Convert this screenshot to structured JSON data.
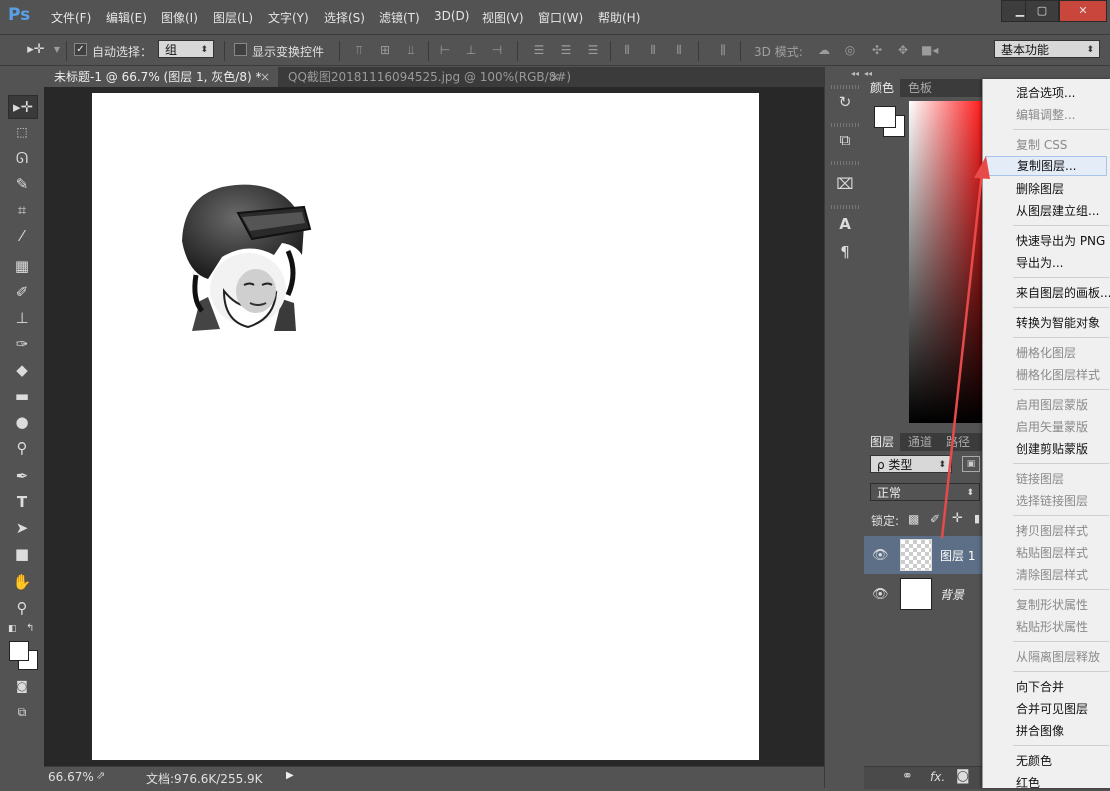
{
  "app": {
    "logo": "Ps"
  },
  "menubar": {
    "items": [
      "文件(F)",
      "编辑(E)",
      "图像(I)",
      "图层(L)",
      "文字(Y)",
      "选择(S)",
      "滤镜(T)",
      "3D(D)",
      "视图(V)",
      "窗口(W)",
      "帮助(H)"
    ]
  },
  "window_controls": {
    "minimize": "▁",
    "maximize": "▢",
    "close": "✕"
  },
  "options": {
    "auto_select_label": "自动选择：",
    "auto_select_value": "组",
    "show_transform_label": "显示变换控件",
    "mode_3d_label": "3D 模式:",
    "workspace_value": "基本功能"
  },
  "tabs": [
    {
      "label": "未标题-1 @ 66.7% (图层 1, 灰色/8) *",
      "close": "×",
      "active": true
    },
    {
      "label": "QQ截图20181116094525.jpg @ 100%(RGB/8#)",
      "close": "×",
      "active": false
    }
  ],
  "status": {
    "zoom": "66.67%",
    "doc_info": "文档:976.6K/255.9K"
  },
  "color_panel": {
    "tabs": [
      "颜色",
      "色板"
    ]
  },
  "layers_panel": {
    "tabs": [
      "图层",
      "通道",
      "路径"
    ],
    "filter_value": "ρ 类型",
    "blend_mode": "正常",
    "lock_label": "锁定:",
    "layers": [
      {
        "name": "图层 1",
        "selected": true,
        "italic": false
      },
      {
        "name": "背景",
        "selected": false,
        "italic": true
      }
    ],
    "footer_fx": "fx."
  },
  "context_menu": {
    "items": [
      {
        "label": "混合选项...",
        "enabled": true
      },
      {
        "label": "编辑调整...",
        "enabled": false
      },
      {
        "label": "复制 CSS",
        "enabled": false
      },
      {
        "label": "复制图层...",
        "enabled": true,
        "highlighted": true
      },
      {
        "label": "删除图层",
        "enabled": true
      },
      {
        "label": "从图层建立组...",
        "enabled": true
      },
      {
        "label": "快速导出为 PNG",
        "enabled": true
      },
      {
        "label": "导出为...",
        "enabled": true
      },
      {
        "label": "来自图层的画板...",
        "enabled": true
      },
      {
        "label": "转换为智能对象",
        "enabled": true
      },
      {
        "label": "栅格化图层",
        "enabled": false
      },
      {
        "label": "栅格化图层样式",
        "enabled": false
      },
      {
        "label": "启用图层蒙版",
        "enabled": false
      },
      {
        "label": "启用矢量蒙版",
        "enabled": false
      },
      {
        "label": "创建剪贴蒙版",
        "enabled": true
      },
      {
        "label": "链接图层",
        "enabled": false
      },
      {
        "label": "选择链接图层",
        "enabled": false
      },
      {
        "label": "拷贝图层样式",
        "enabled": false
      },
      {
        "label": "粘贴图层样式",
        "enabled": false
      },
      {
        "label": "清除图层样式",
        "enabled": false
      },
      {
        "label": "复制形状属性",
        "enabled": false
      },
      {
        "label": "粘贴形状属性",
        "enabled": false
      },
      {
        "label": "从隔离图层释放",
        "enabled": false
      },
      {
        "label": "向下合并",
        "enabled": true
      },
      {
        "label": "合并可见图层",
        "enabled": true
      },
      {
        "label": "拼合图像",
        "enabled": true
      },
      {
        "label": "无颜色",
        "enabled": true
      },
      {
        "label": "红色",
        "enabled": true
      }
    ]
  },
  "colors": {
    "accent_arrow": "#e84a4a",
    "selected_layer": "#5d6f86",
    "menu_highlight": "#e4ecf7"
  }
}
